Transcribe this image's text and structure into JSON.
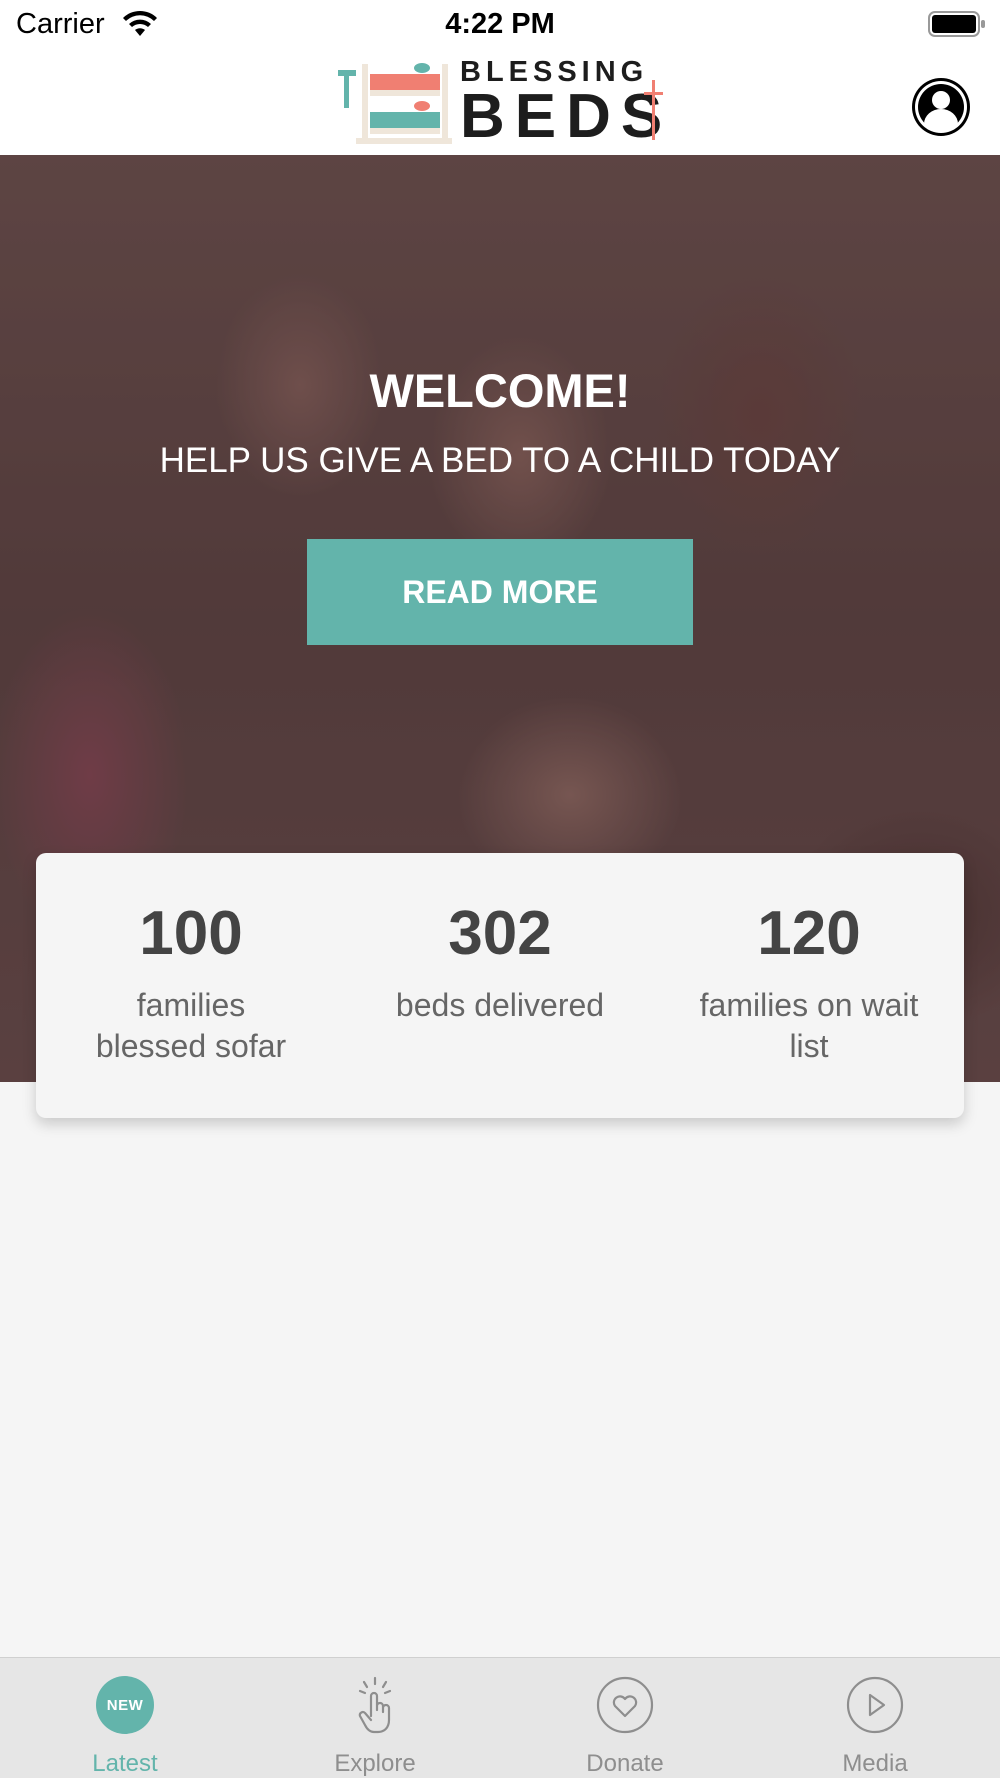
{
  "status_bar": {
    "carrier": "Carrier",
    "time": "4:22 PM"
  },
  "header": {
    "logo_top": "BLESSING",
    "logo_bottom": "BEDS",
    "profile_icon": "user-icon"
  },
  "hero": {
    "title": "WELCOME!",
    "subtitle": "HELP US GIVE A BED TO A CHILD TODAY",
    "button_label": "READ MORE"
  },
  "stats": [
    {
      "value": "100",
      "label": "families blessed sofar"
    },
    {
      "value": "302",
      "label": "beds delivered"
    },
    {
      "value": "120",
      "label": "families on wait list"
    }
  ],
  "tab_bar": {
    "tabs": [
      {
        "label": "Latest",
        "icon": "new-badge-icon",
        "badge": "NEW",
        "active": true
      },
      {
        "label": "Explore",
        "icon": "tap-hand-icon",
        "active": false
      },
      {
        "label": "Donate",
        "icon": "heart-icon",
        "active": false
      },
      {
        "label": "Media",
        "icon": "play-icon",
        "active": false
      }
    ]
  },
  "colors": {
    "accent": "#63b4ab",
    "logo_coral": "#f07f72",
    "logo_teal": "#63b4ab"
  }
}
